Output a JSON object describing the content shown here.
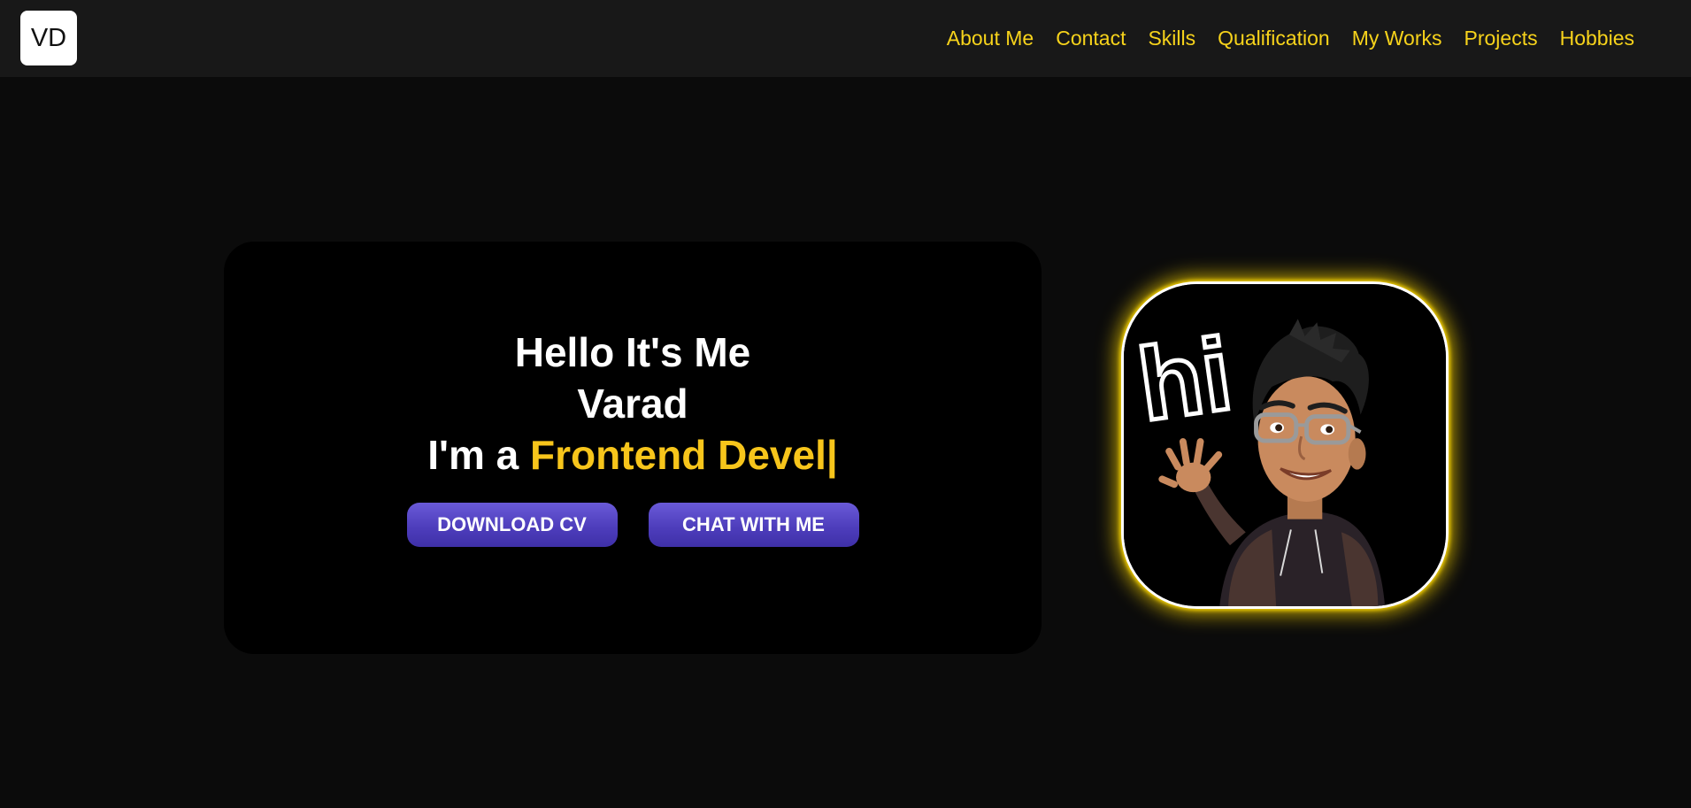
{
  "logo": {
    "text": "VD"
  },
  "nav": {
    "items": [
      {
        "label": "About Me"
      },
      {
        "label": "Contact"
      },
      {
        "label": "Skills"
      },
      {
        "label": "Qualification"
      },
      {
        "label": "My Works"
      },
      {
        "label": "Projects"
      },
      {
        "label": "Hobbies"
      }
    ]
  },
  "hero": {
    "line1": "Hello It's Me",
    "line2": "Varad",
    "role_prefix": "I'm a ",
    "role_typed": "Frontend Devel|",
    "download_button": "DOWNLOAD CV",
    "chat_button": "CHAT WITH ME"
  },
  "avatar": {
    "icon": "waving-avatar-illustration",
    "greeting_text": "hi"
  },
  "colors": {
    "background": "#0b0b0b",
    "navbar": "#181818",
    "nav_link": "#f7d31b",
    "accent_yellow": "#f7c51b",
    "button": "#5646c8"
  }
}
